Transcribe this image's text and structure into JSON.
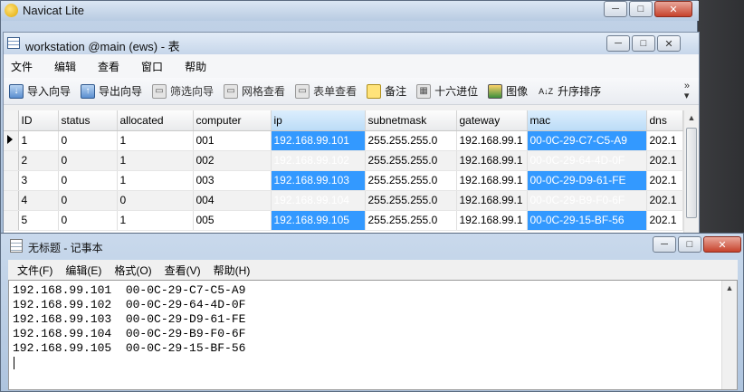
{
  "navicat": {
    "app_title": "Navicat Lite",
    "table_window_title": "workstation @main (ews) - 表",
    "menu": [
      "文件",
      "编辑",
      "查看",
      "窗口",
      "帮助"
    ],
    "toolbar": {
      "import_wizard": "导入向导",
      "export_wizard": "导出向导",
      "filter_wizard": "筛选向导",
      "grid_view": "网格查看",
      "form_view": "表单查看",
      "memo": "备注",
      "hex": "十六进位",
      "image": "图像",
      "sort_asc": "升序排序",
      "more": "»"
    },
    "grid": {
      "columns": [
        "ID",
        "status",
        "allocated",
        "computer",
        "ip",
        "subnetmask",
        "gateway",
        "mac",
        "dns"
      ],
      "highlight_columns": [
        "ip",
        "mac"
      ],
      "rows": [
        [
          "1",
          "0",
          "1",
          "001",
          "192.168.99.101",
          "255.255.255.0",
          "192.168.99.1",
          "00-0C-29-C7-C5-A9",
          "202.1"
        ],
        [
          "2",
          "0",
          "1",
          "002",
          "192.168.99.102",
          "255.255.255.0",
          "192.168.99.1",
          "00-0C-29-64-4D-0F",
          "202.1"
        ],
        [
          "3",
          "0",
          "1",
          "003",
          "192.168.99.103",
          "255.255.255.0",
          "192.168.99.1",
          "00-0C-29-D9-61-FE",
          "202.1"
        ],
        [
          "4",
          "0",
          "0",
          "004",
          "192.168.99.104",
          "255.255.255.0",
          "192.168.99.1",
          "00-0C-29-B9-F0-6F",
          "202.1"
        ],
        [
          "5",
          "0",
          "1",
          "005",
          "192.168.99.105",
          "255.255.255.0",
          "192.168.99.1",
          "00-0C-29-15-BF-56",
          "202.1"
        ]
      ]
    }
  },
  "notepad": {
    "title": "无标题 - 记事本",
    "menu": [
      "文件(F)",
      "编辑(E)",
      "格式(O)",
      "查看(V)",
      "帮助(H)"
    ],
    "content": "192.168.99.101  00-0C-29-C7-C5-A9\n192.168.99.102  00-0C-29-64-4D-0F\n192.168.99.103  00-0C-29-D9-61-FE\n192.168.99.104  00-0C-29-B9-F0-6F\n192.168.99.105  00-0C-29-15-BF-56"
  },
  "colors": {
    "selection": "#3399ff",
    "header_highlight": "#bcdcf7"
  }
}
